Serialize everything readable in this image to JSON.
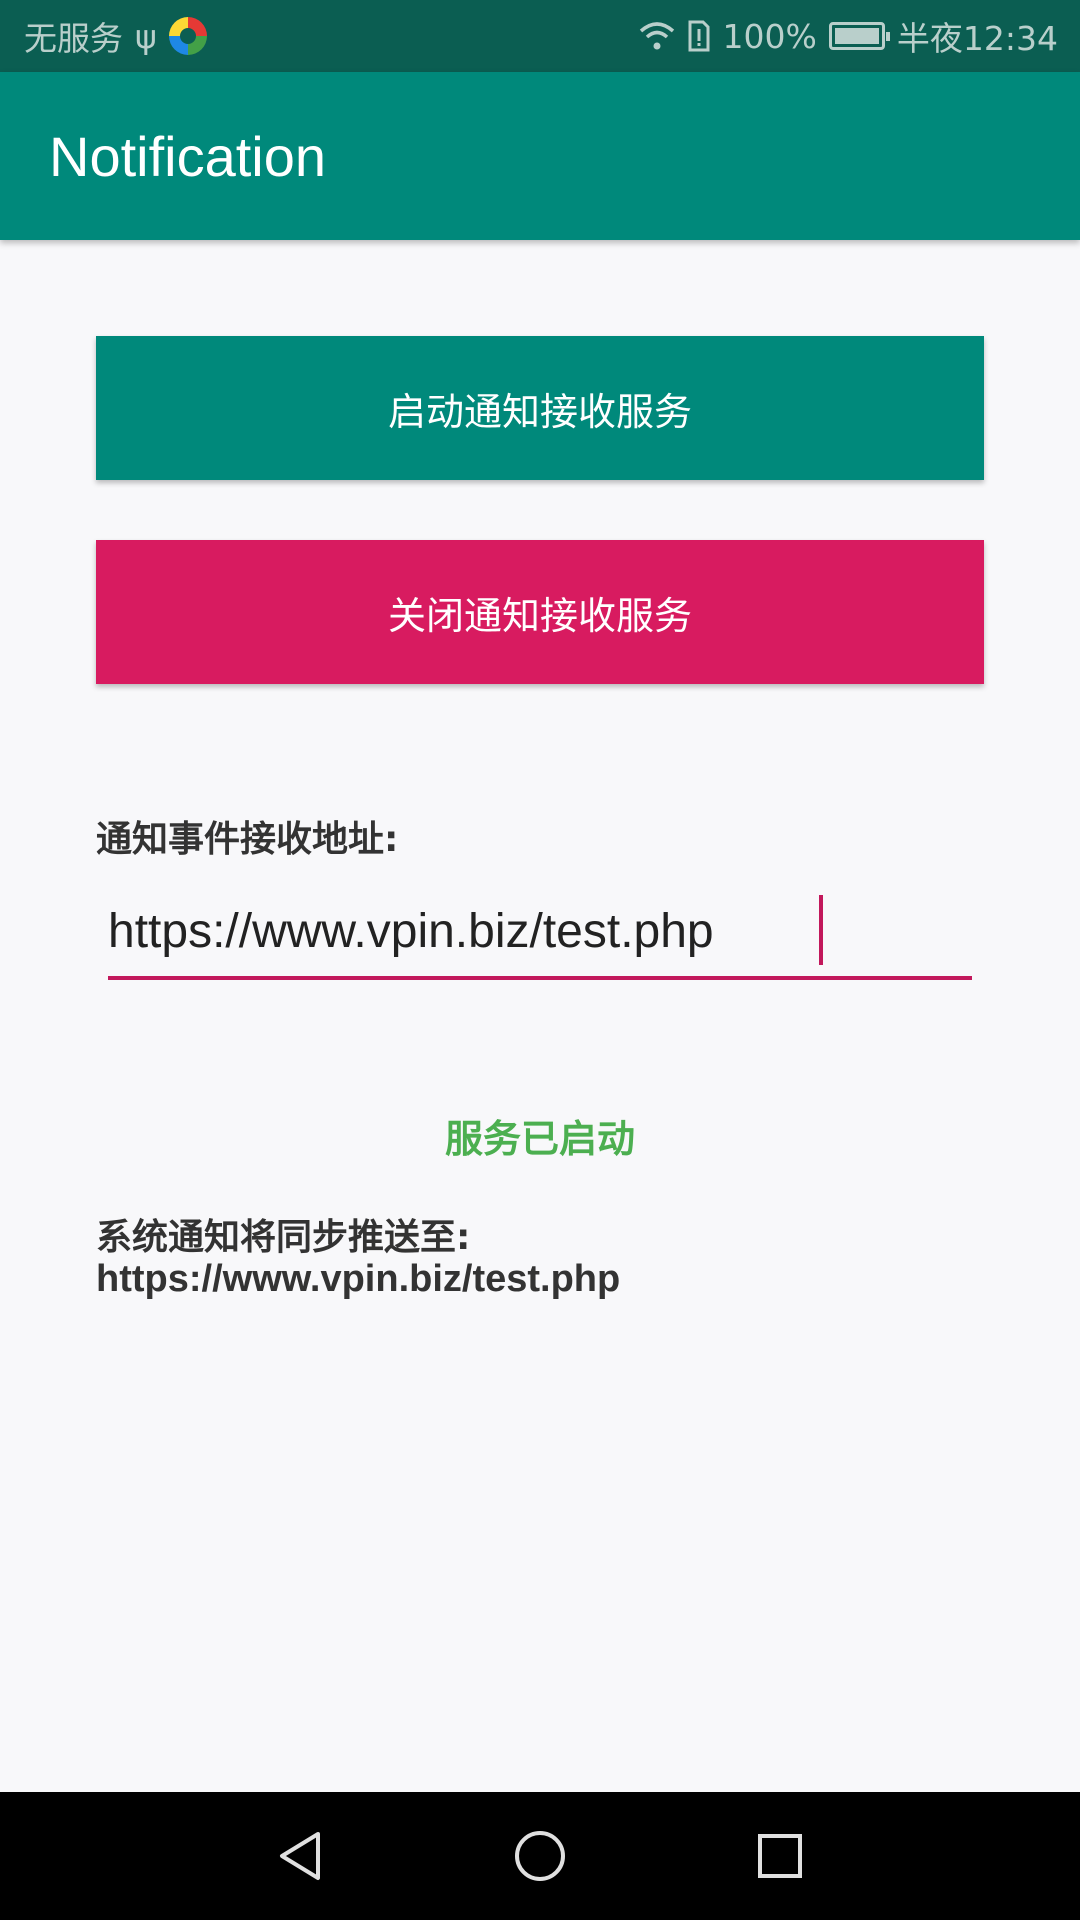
{
  "status_bar": {
    "carrier": "无服务",
    "usb_symbol": "ψ",
    "battery_percent": "100%",
    "time": "半夜12:34"
  },
  "app_bar": {
    "title": "Notification"
  },
  "buttons": {
    "start_label": "启动通知接收服务",
    "stop_label": "关闭通知接收服务"
  },
  "form": {
    "label": "通知事件接收地址:",
    "url_value": "https://www.vpin.biz/test.php"
  },
  "status": {
    "service_status": "服务已启动",
    "sync_label": "系统通知将同步推送至:",
    "sync_url": "https://www.vpin.biz/test.php"
  },
  "colors": {
    "primary": "#00897b",
    "accent": "#d81b60",
    "success": "#4caf50"
  },
  "icons": {
    "nav_back": "back-icon",
    "nav_home": "home-icon",
    "nav_recents": "recents-icon"
  }
}
